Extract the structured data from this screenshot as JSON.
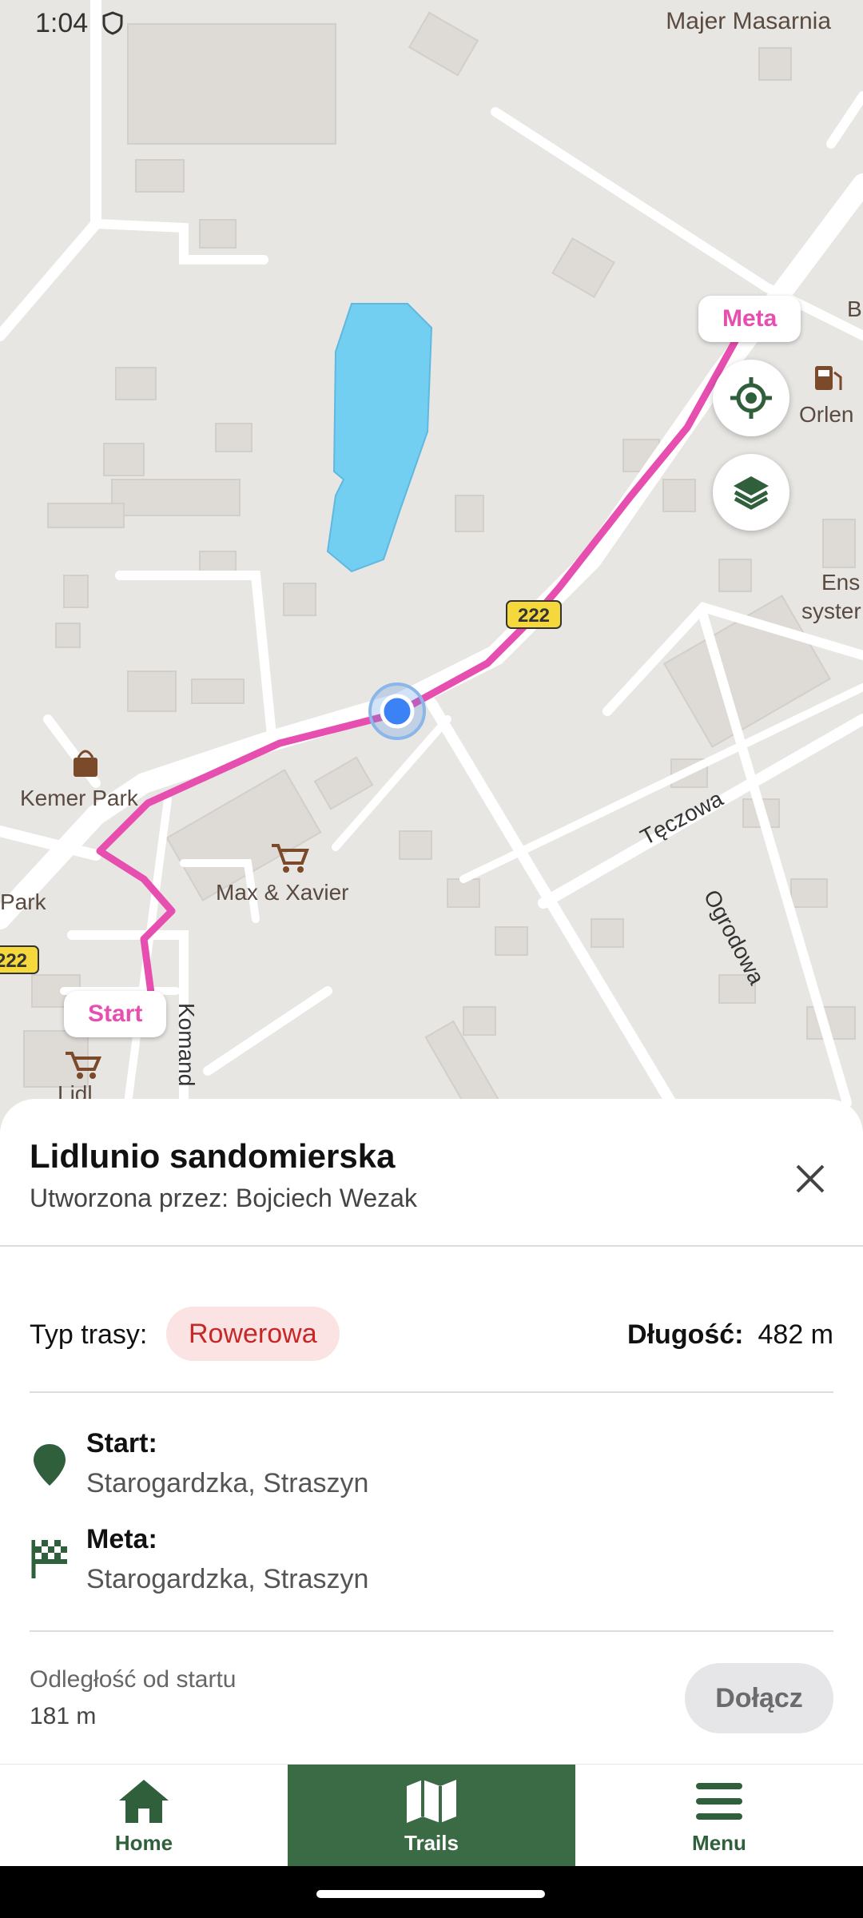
{
  "status_bar": {
    "time": "1:04",
    "carrier_overlay": "Majer Masarnia"
  },
  "map": {
    "route_color": "#e64fb0",
    "place_labels": [
      "Kemer Park",
      "Park",
      "Max & Xavier",
      "Orlen",
      "Ens",
      "syster",
      "Lidl",
      "B"
    ],
    "street_labels": [
      "Tęczowa",
      "Ogrodowa",
      "Komand"
    ],
    "road_badges": [
      "222",
      "222"
    ],
    "start_pin_label": "Start",
    "end_pin_label": "Meta"
  },
  "sheet": {
    "title": "Lidlunio sandomierska",
    "subtitle": "Utworzona przez: Bojciech Wezak",
    "type_label": "Typ trasy:",
    "type_value": "Rowerowa",
    "length_label": "Długość:",
    "length_value": "482 m",
    "start_label": "Start:",
    "start_address": "Starogardzka, Straszyn",
    "end_label": "Meta:",
    "end_address": "Starogardzka, Straszyn",
    "distance_label": "Odległość od startu",
    "distance_value": "181 m",
    "join_label": "Dołącz"
  },
  "nav": {
    "items": [
      {
        "label": "Home",
        "icon": "home-icon"
      },
      {
        "label": "Trails",
        "icon": "map-icon",
        "active": true
      },
      {
        "label": "Menu",
        "icon": "menu-icon"
      }
    ]
  },
  "colors": {
    "accent": "#3a6b44",
    "route": "#e64fb0",
    "chip_bg": "#fbe3e3",
    "chip_text": "#c62828"
  }
}
